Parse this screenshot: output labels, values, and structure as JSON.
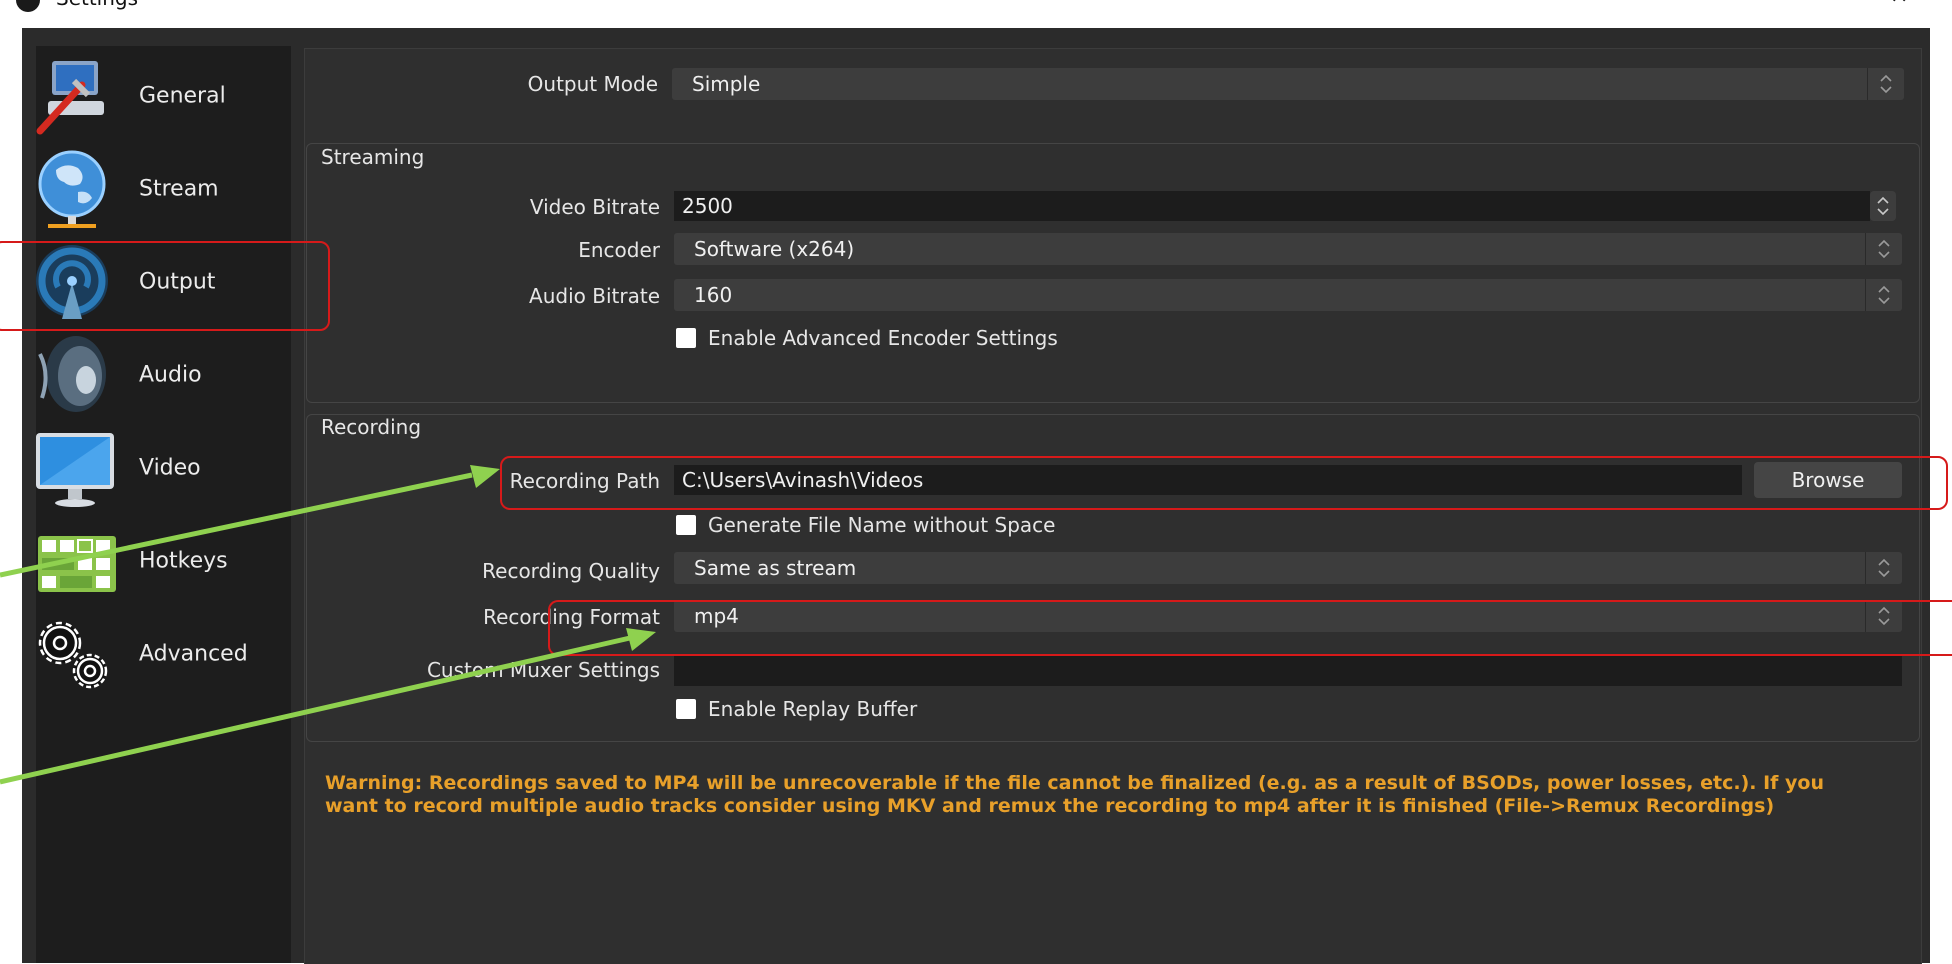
{
  "window": {
    "title": "Settings",
    "minimize_glyph": "–",
    "close_glyph": "✕"
  },
  "sidebar": {
    "items": [
      {
        "label": "General",
        "icon": "general-icon"
      },
      {
        "label": "Stream",
        "icon": "globe-icon"
      },
      {
        "label": "Output",
        "icon": "broadcast-icon"
      },
      {
        "label": "Audio",
        "icon": "speaker-icon"
      },
      {
        "label": "Video",
        "icon": "monitor-icon"
      },
      {
        "label": "Hotkeys",
        "icon": "keyboard-icon"
      },
      {
        "label": "Advanced",
        "icon": "gears-icon"
      }
    ],
    "selected": "Output"
  },
  "output": {
    "mode": {
      "label": "Output Mode",
      "value": "Simple"
    },
    "streaming": {
      "title": "Streaming",
      "video_bitrate": {
        "label": "Video Bitrate",
        "value": "2500"
      },
      "encoder": {
        "label": "Encoder",
        "value": "Software (x264)"
      },
      "audio_bitrate": {
        "label": "Audio Bitrate",
        "value": "160"
      },
      "advanced_encoder": {
        "label": "Enable Advanced Encoder Settings",
        "checked": false
      }
    },
    "recording": {
      "title": "Recording",
      "path": {
        "label": "Recording Path",
        "value": "C:\\Users\\Avinash\\Videos",
        "browse_label": "Browse"
      },
      "no_space": {
        "label": "Generate File Name without Space",
        "checked": false
      },
      "quality": {
        "label": "Recording Quality",
        "value": "Same as stream"
      },
      "format": {
        "label": "Recording Format",
        "value": "mp4"
      },
      "muxer": {
        "label": "Custom Muxer Settings",
        "value": ""
      },
      "replay_buffer": {
        "label": "Enable Replay Buffer",
        "checked": false
      }
    },
    "warning_line1": "Warning: Recordings saved to MP4 will be unrecoverable if the file cannot be finalized (e.g. as a result of BSODs, power losses, etc.). If you",
    "warning_line2": "want to record multiple audio tracks consider using MKV and remux the recording to mp4 after it is finished (File->Remux Recordings)"
  },
  "colors": {
    "highlight": "#d61a1a",
    "annotation_arrow": "#8fd14f",
    "warning_text": "#e8a02a"
  }
}
